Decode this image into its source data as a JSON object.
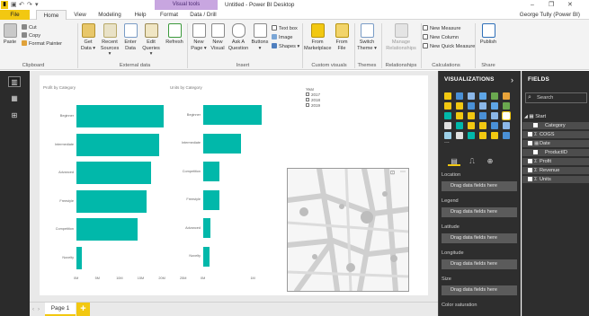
{
  "titlebar": {
    "app_icon": "pbi-logo-icon",
    "quick_access": [
      "save-icon",
      "undo-icon",
      "redo-icon",
      "customize-qat-icon"
    ],
    "contextual_tab": "Visual tools",
    "title": "Untitled - Power BI Desktop",
    "window_controls": [
      "minimize-icon",
      "restore-icon",
      "close-icon"
    ]
  },
  "tabs": {
    "file": "File",
    "home": "Home",
    "view": "View",
    "modeling": "Modeling",
    "help": "Help",
    "format": "Format",
    "data_drill": "Data / Drill",
    "user": "George Tully (Power BI)"
  },
  "ribbon": {
    "clipboard": {
      "paste": "Paste",
      "cut": "Cut",
      "copy": "Copy",
      "format_painter": "Format Painter",
      "label": "Clipboard"
    },
    "external": {
      "get_data": [
        "Get",
        "Data ▾"
      ],
      "recent_sources": [
        "Recent",
        "Sources ▾"
      ],
      "enter_data": [
        "Enter",
        "Data"
      ],
      "edit_queries": [
        "Edit",
        "Queries ▾"
      ],
      "refresh": [
        "Refresh",
        ""
      ],
      "label": "External data"
    },
    "insert": {
      "new_page": [
        "New",
        "Page ▾"
      ],
      "new_visual": [
        "New",
        "Visual"
      ],
      "ask_question": [
        "Ask A",
        "Question"
      ],
      "buttons": [
        "Buttons",
        "▾"
      ],
      "text_box": "Text box",
      "image": "Image",
      "shapes": "Shapes ▾",
      "label": "Insert"
    },
    "custom": {
      "marketplace": [
        "From",
        "Marketplace"
      ],
      "file": [
        "From",
        "File"
      ],
      "label": "Custom visuals"
    },
    "themes": {
      "switch": [
        "Switch",
        "Theme ▾"
      ],
      "label": "Themes"
    },
    "relationships": {
      "manage": [
        "Manage",
        "Relationships"
      ],
      "label": "Relationships"
    },
    "calculations": {
      "new_measure": "New Measure",
      "new_column": "New Column",
      "new_quick_measure": "New Quick Measure",
      "label": "Calculations"
    },
    "share": {
      "publish": "Publish",
      "label": "Share"
    }
  },
  "leftnav": {
    "items": [
      "report-view-icon",
      "data-view-icon",
      "relationships-view-icon"
    ]
  },
  "canvas": {
    "chart1_title": "Profit by Category",
    "chart2_title": "Units by Category",
    "legend_title": "Year",
    "legend_items": [
      "2017",
      "2018",
      "2019"
    ],
    "map_placeholder": "map-placeholder-icon"
  },
  "chart_data": [
    {
      "type": "bar",
      "title": "Profit by Category",
      "categories": [
        "Beginner",
        "Intermediate",
        "Advanced",
        "Freestyle",
        "Competition",
        "Novelty"
      ],
      "values": [
        20.5,
        19.5,
        17.5,
        16.5,
        14.5,
        1.2
      ],
      "xticks": [
        "0M",
        "5M",
        "10M",
        "15M",
        "20M",
        "25M"
      ],
      "xlim": [
        0,
        25
      ]
    },
    {
      "type": "bar",
      "title": "Units by Category",
      "categories": [
        "Beginner",
        "Intermediate",
        "Competition",
        "Freestyle",
        "Advanced",
        "Novelty"
      ],
      "values": [
        1.16,
        0.75,
        0.33,
        0.33,
        0.14,
        0.12
      ],
      "xticks": [
        "0M",
        "1M"
      ],
      "xlim": [
        0,
        1.58
      ]
    }
  ],
  "pagebar": {
    "page1": "Page 1",
    "add": "+"
  },
  "visualizations": {
    "header": "VISUALIZATIONS",
    "expand": "›",
    "more": "...",
    "wells": [
      "Location",
      "Legend",
      "Latitude",
      "Longitude",
      "Size",
      "Color saturation"
    ],
    "drop_text": "Drag data fields here"
  },
  "fields": {
    "header": "FIELDS",
    "search_placeholder": "Search",
    "table": "Start",
    "items": [
      {
        "label": "Category",
        "level": 2,
        "type": "field"
      },
      {
        "label": "COGS",
        "level": 1,
        "type": "sigma"
      },
      {
        "label": "Date",
        "level": 1,
        "type": "date"
      },
      {
        "label": "ProductID",
        "level": 2,
        "type": "field"
      },
      {
        "label": "Profit",
        "level": 1,
        "type": "sigma"
      },
      {
        "label": "Revenue",
        "level": 1,
        "type": "sigma"
      },
      {
        "label": "Units",
        "level": 1,
        "type": "sigma"
      }
    ]
  },
  "colors": {
    "accent": "#f2c811",
    "bar": "#01b8aa",
    "pane": "#2e2e2e",
    "contextual_tab": "#c8a6e0"
  }
}
